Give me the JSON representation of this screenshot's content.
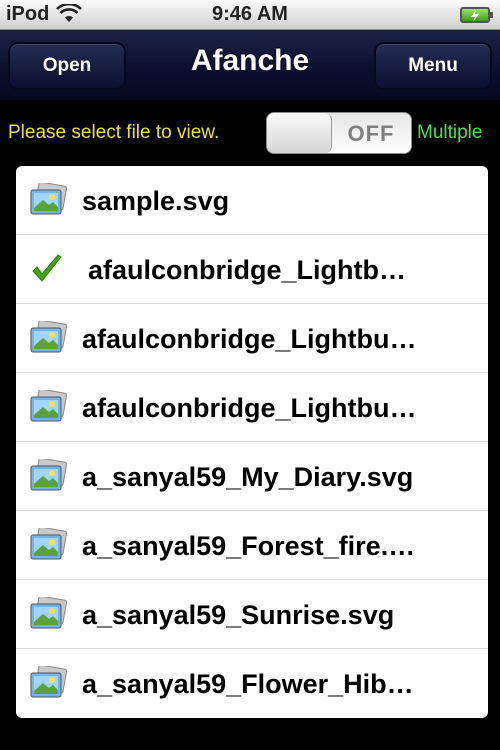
{
  "status_bar": {
    "carrier": "iPod",
    "time": "9:46 AM",
    "wifi_icon": "wifi-icon",
    "battery_icon": "battery-charging-icon"
  },
  "nav": {
    "left_button": "Open",
    "title": "Afanche",
    "right_button": "Menu"
  },
  "instruction": {
    "text": "Please select file to view.",
    "toggle_state": "OFF",
    "toggle_side_label": "Multiple"
  },
  "files": [
    {
      "name": "sample.svg",
      "icon": "image-file-icon",
      "checked": false
    },
    {
      "name": "afaulconbridge_Lightb…",
      "icon": "checkmark-icon",
      "checked": true
    },
    {
      "name": "afaulconbridge_Lightbu…",
      "icon": "image-file-icon",
      "checked": false
    },
    {
      "name": "afaulconbridge_Lightbu…",
      "icon": "image-file-icon",
      "checked": false
    },
    {
      "name": "a_sanyal59_My_Diary.svg",
      "icon": "image-file-icon",
      "checked": false
    },
    {
      "name": "a_sanyal59_Forest_fire.…",
      "icon": "image-file-icon",
      "checked": false
    },
    {
      "name": "a_sanyal59_Sunrise.svg",
      "icon": "image-file-icon",
      "checked": false
    },
    {
      "name": "a_sanyal59_Flower_Hib…",
      "icon": "image-file-icon",
      "checked": false
    }
  ],
  "colors": {
    "nav_background": "#0c1230",
    "instruction_text": "#e9e23a",
    "multiple_label": "#4be04b",
    "checkmark": "#3fa814"
  }
}
